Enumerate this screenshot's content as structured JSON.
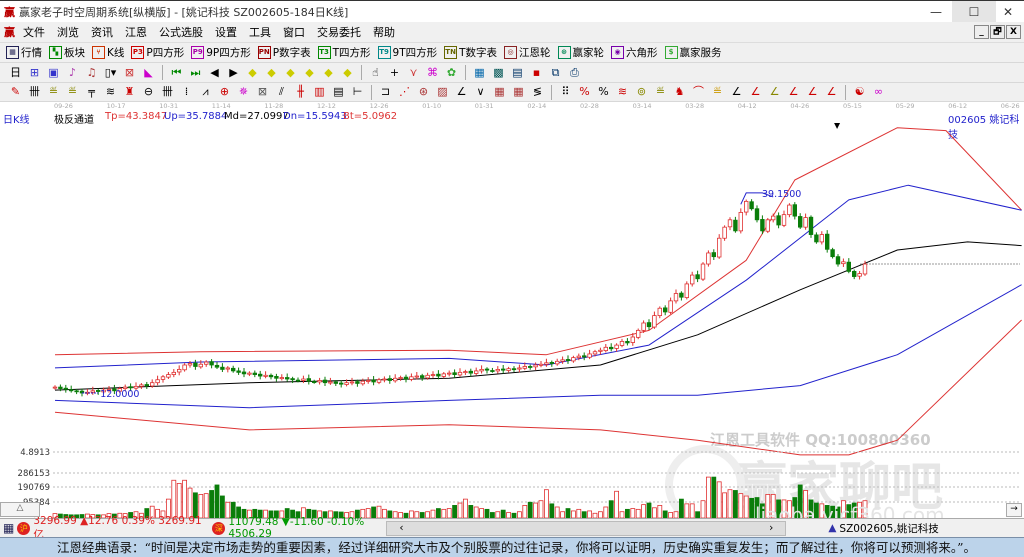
{
  "window": {
    "title": "赢家老子时空周期系统[纵横版] - [姚记科技  SZ002605-184日K线]",
    "logo": "赢",
    "minimize": "—",
    "maximize": "☐",
    "close": "✕"
  },
  "menu": [
    "文件",
    "浏览",
    "资讯",
    "江恩",
    "公式选股",
    "设置",
    "工具",
    "窗口",
    "交易委托",
    "帮助"
  ],
  "mdi": [
    "_",
    "🗗",
    "X"
  ],
  "toolbar1": [
    {
      "icon": "grid-icon",
      "glyph": "▦",
      "color": "#225",
      "label": "行情"
    },
    {
      "icon": "blocks-icon",
      "glyph": "▚",
      "color": "#080",
      "label": "板块"
    },
    {
      "icon": "kline-icon",
      "glyph": "⑂",
      "color": "#c30",
      "label": "K线"
    },
    {
      "icon": "p3-icon",
      "glyph": "P3",
      "color": "#c00",
      "label": "P四方形"
    },
    {
      "icon": "p9-icon",
      "glyph": "P9",
      "color": "#a0a",
      "label": "9P四方形"
    },
    {
      "icon": "pn-icon",
      "glyph": "PN",
      "color": "#900",
      "label": "P数字表"
    },
    {
      "icon": "t3-icon",
      "glyph": "T3",
      "color": "#080",
      "label": "T四方形"
    },
    {
      "icon": "t9-icon",
      "glyph": "T9",
      "color": "#088",
      "label": "9T四方形"
    },
    {
      "icon": "tn-icon",
      "glyph": "TN",
      "color": "#660",
      "label": "T数字表"
    },
    {
      "icon": "target-icon",
      "glyph": "◎",
      "color": "#822",
      "label": "江恩轮"
    },
    {
      "icon": "wheel-icon",
      "glyph": "⊛",
      "color": "#085",
      "label": "赢家轮"
    },
    {
      "icon": "hexagon-icon",
      "glyph": "◉",
      "color": "#70a",
      "label": "六角形"
    },
    {
      "icon": "dollar-icon",
      "glyph": "$",
      "color": "#3a3",
      "label": "赢家服务"
    }
  ],
  "toolbar2": [
    [
      "period-day-icon",
      "日▾",
      "#000"
    ],
    [
      "draw-icon",
      "⊞",
      "#33c"
    ],
    [
      "note-icon",
      "▣",
      "#33c"
    ],
    [
      "wave-icon",
      "♪",
      "#a3a"
    ],
    [
      "wave2-icon",
      "♫",
      "#a33"
    ],
    [
      "candle-icon",
      "▯▾",
      "#000"
    ],
    [
      "cross-icon",
      "⊠",
      "#c33"
    ],
    [
      "chart-flag-icon",
      "◣",
      "#c0c"
    ],
    [
      "sep"
    ],
    [
      "first-icon",
      "⏮",
      "#080"
    ],
    [
      "last-icon",
      "⏭",
      "#080"
    ],
    [
      "left-icon",
      "◀",
      "#000"
    ],
    [
      "right-icon",
      "▶",
      "#000"
    ],
    [
      "diamond1-icon",
      "◆",
      "#cc0"
    ],
    [
      "diamond2-icon",
      "◆",
      "#cc0"
    ],
    [
      "diamond3-icon",
      "◆",
      "#cc0"
    ],
    [
      "diamond4-icon",
      "◆",
      "#cc0"
    ],
    [
      "diamond5-icon",
      "◆",
      "#cc0"
    ],
    [
      "diamond6-icon",
      "◆",
      "#cc0"
    ],
    [
      "sep"
    ],
    [
      "hand-icon",
      "☝",
      "#000"
    ],
    [
      "crosshair-icon",
      "+",
      "#000"
    ],
    [
      "zigzag-icon",
      "⋎",
      "#c33"
    ],
    [
      "gift-icon",
      "⌘",
      "#c0c"
    ],
    [
      "people-icon",
      "✿",
      "#3a3"
    ],
    [
      "sep"
    ],
    [
      "calendar-icon",
      "▦",
      "#06a"
    ],
    [
      "calc-icon",
      "▩",
      "#055"
    ],
    [
      "doc-icon",
      "▤",
      "#036"
    ],
    [
      "save-icon",
      "▪",
      "#c00"
    ],
    [
      "network-icon",
      "⧉",
      "#036"
    ],
    [
      "print-icon",
      "⎙",
      "#036"
    ]
  ],
  "toolbar3": [
    [
      "pen-icon",
      "✎",
      "#c00"
    ],
    [
      "bars-icon",
      "卌",
      "#000"
    ],
    [
      "gold1-icon",
      "≝",
      "#880"
    ],
    [
      "gold2-icon",
      "≝",
      "#880"
    ],
    [
      "fork-icon",
      "╤",
      "#000"
    ],
    [
      "coil-icon",
      "≋",
      "#000"
    ],
    [
      "pin-icon",
      "♜",
      "#c00"
    ],
    [
      "circle-lines-icon",
      "⊖",
      "#000"
    ],
    [
      "bars2-icon",
      "卌",
      "#000"
    ],
    [
      "grid-n-icon",
      "⁞",
      "#000"
    ],
    [
      "fan-icon",
      "⩘",
      "#000"
    ],
    [
      "cross-circle-icon",
      "⊕",
      "#c00"
    ],
    [
      "star-icon",
      "✵",
      "#c0c"
    ],
    [
      "box-x-icon",
      "⊠",
      "#555"
    ],
    [
      "slant-icon",
      "⫽",
      "#000"
    ],
    [
      "red-fork-icon",
      "╫",
      "#c00"
    ],
    [
      "red-box-icon",
      "▥",
      "#c00"
    ],
    [
      "stack-icon",
      "▤",
      "#000"
    ],
    [
      "span-icon",
      "⊢",
      "#000"
    ],
    [
      "sep"
    ],
    [
      "frame-icon",
      "⊐",
      "#000"
    ],
    [
      "ray-icon",
      "⋰",
      "#c00"
    ],
    [
      "spiral-icon",
      "⊛",
      "#a33"
    ],
    [
      "grid-red-icon",
      "▨",
      "#a33"
    ],
    [
      "angle-icon",
      "∠",
      "#000"
    ],
    [
      "vee-icon",
      "∨",
      "#000"
    ],
    [
      "mesh-icon",
      "▦",
      "#a33"
    ],
    [
      "mesh2-icon",
      "▦",
      "#a33"
    ],
    [
      "lines-icon",
      "≶",
      "#000"
    ],
    [
      "sep"
    ],
    [
      "matrix-icon",
      "⠿",
      "#000"
    ],
    [
      "percent-red-icon",
      "%",
      "#c00"
    ],
    [
      "percent-icon",
      "%",
      "#000"
    ],
    [
      "percent-lines-icon",
      "≋",
      "#c00"
    ],
    [
      "coin-icon",
      "⊚",
      "#880"
    ],
    [
      "gold3-icon",
      "≝",
      "#880"
    ],
    [
      "bull-icon",
      "♞",
      "#c00"
    ],
    [
      "arc-icon",
      "⌒",
      "#c00"
    ],
    [
      "gold4-icon",
      "≝",
      "#c90"
    ],
    [
      "angle2-icon",
      "∠",
      "#000"
    ],
    [
      "angle3-icon",
      "∠",
      "#c00"
    ],
    [
      "angle4-icon",
      "∠",
      "#880"
    ],
    [
      "angle5-icon",
      "∠",
      "#c00"
    ],
    [
      "angle6-icon",
      "∠",
      "#c00"
    ],
    [
      "angle7-icon",
      "∠",
      "#c00"
    ],
    [
      "sep"
    ],
    [
      "yinyang-icon",
      "☯",
      "#c00"
    ],
    [
      "infinity-icon",
      "∞",
      "#c0c"
    ]
  ],
  "date_axis": [
    "09-26",
    "10-17",
    "10-31",
    "11-14",
    "11-28",
    "12-12",
    "12-26",
    "01-10",
    "01-31",
    "02-14",
    "02-28",
    "03-14",
    "03-28",
    "04-12",
    "04-26",
    "05-15",
    "05-29",
    "06-12",
    "06-26"
  ],
  "indicator": {
    "period": "日K线",
    "name": "极反通道",
    "tp": "Tp=43.3847",
    "up": "Up=35.7884",
    "md": "Md=27.0997",
    "dn": "Dn=15.5943",
    "bt": "Bt=5.0962",
    "stock": "002605  姚记科技"
  },
  "colors": {
    "up": "#e03030",
    "down": "#0a7d0a",
    "tp": "#d33",
    "upline": "#2222cc",
    "md": "#000",
    "dn": "#2222cc",
    "bt": "#d33"
  },
  "chart_data": {
    "type": "candlestick",
    "title": "姚记科技 SZ002605 日K线",
    "annotations": {
      "high": "39.1500",
      "low": "12.0000",
      "high_value": 39.15,
      "low_value": 12.0
    },
    "close": [
      12.8,
      12.6,
      12.5,
      12.3,
      12.2,
      12.0,
      12.1,
      12.3,
      12.2,
      12.4,
      12.5,
      12.3,
      12.6,
      12.8,
      12.7,
      12.9,
      13.1,
      13.0,
      13.4,
      13.8,
      14.2,
      14.5,
      14.8,
      15.2,
      15.8,
      16.0,
      15.6,
      15.9,
      16.2,
      15.8,
      15.5,
      15.2,
      15.4,
      15.0,
      14.8,
      14.6,
      14.7,
      14.5,
      14.3,
      14.4,
      14.2,
      14.0,
      14.1,
      13.9,
      13.8,
      13.7,
      13.9,
      13.6,
      13.5,
      13.7,
      13.4,
      13.5,
      13.3,
      13.2,
      13.4,
      13.5,
      13.3,
      13.6,
      13.7,
      13.5,
      13.8,
      13.9,
      13.7,
      14.0,
      14.1,
      13.9,
      14.2,
      14.3,
      14.1,
      14.4,
      14.5,
      14.3,
      14.6,
      14.7,
      14.5,
      14.8,
      14.9,
      14.7,
      15.0,
      15.2,
      15.1,
      15.0,
      15.2,
      15.1,
      15.3,
      15.2,
      15.4,
      15.6,
      15.5,
      15.8,
      15.9,
      16.1,
      16.0,
      16.3,
      16.5,
      16.4,
      16.8,
      17.0,
      16.9,
      17.3,
      17.6,
      17.8,
      18.2,
      18.0,
      18.5,
      19.0,
      18.8,
      19.6,
      20.5,
      21.5,
      21.0,
      22.5,
      23.5,
      23.0,
      24.5,
      25.5,
      25.0,
      26.8,
      28.0,
      27.5,
      29.5,
      31.0,
      30.5,
      33.0,
      34.5,
      35.5,
      34.0,
      36.5,
      38.0,
      37.0,
      35.5,
      34.0,
      35.5,
      36.0,
      34.8,
      36.2,
      37.5,
      36.0,
      34.5,
      35.8,
      33.5,
      32.5,
      33.5,
      31.5,
      30.5,
      29.5,
      29.8,
      28.5,
      27.8,
      28.2,
      29.5
    ],
    "volume": [
      28000,
      25000,
      22000,
      20000,
      20000,
      22000,
      25000,
      22000,
      20000,
      20000,
      28000,
      25000,
      30000,
      28000,
      35000,
      40000,
      30000,
      60000,
      75000,
      55000,
      45000,
      120000,
      240000,
      220000,
      240000,
      190000,
      160000,
      150000,
      155000,
      175000,
      210000,
      140000,
      100000,
      100000,
      70000,
      55000,
      50000,
      55000,
      50000,
      50000,
      45000,
      45000,
      45000,
      60000,
      50000,
      40000,
      65000,
      55000,
      50000,
      45000,
      40000,
      45000,
      40000,
      38000,
      35000,
      40000,
      50000,
      55000,
      60000,
      70000,
      75000,
      55000,
      45000,
      40000,
      35000,
      30000,
      45000,
      40000,
      35000,
      40000,
      50000,
      60000,
      55000,
      60000,
      80000,
      95000,
      120000,
      80000,
      70000,
      60000,
      55000,
      35000,
      40000,
      50000,
      35000,
      30000,
      40000,
      80000,
      100000,
      95000,
      110000,
      180000,
      90000,
      70000,
      40000,
      60000,
      45000,
      55000,
      40000,
      45000,
      30000,
      40000,
      70000,
      110000,
      170000,
      40000,
      55000,
      60000,
      55000,
      85000,
      95000,
      65000,
      80000,
      45000,
      35000,
      40000,
      120000,
      90000,
      90000,
      40000,
      110000,
      260000,
      260000,
      230000,
      160000,
      180000,
      175000,
      155000,
      140000,
      125000,
      130000,
      90000,
      150000,
      150000,
      115000,
      115000,
      110000,
      130000,
      210000,
      175000,
      115000,
      95000,
      90000,
      80000,
      75000,
      70000,
      110000,
      85000,
      95000,
      100000,
      110000
    ],
    "bands": {
      "Tp": [
        [
          0,
          17.2
        ],
        [
          27,
          17.6
        ],
        [
          73,
          17.8
        ],
        [
          91,
          17.2
        ],
        [
          110,
          20.5
        ],
        [
          128,
          30
        ],
        [
          137,
          40.9
        ],
        [
          156,
          48
        ],
        [
          165,
          47.6
        ],
        [
          179,
          36.8
        ]
      ],
      "Up": [
        [
          0,
          15.4
        ],
        [
          27,
          16.2
        ],
        [
          73,
          16.7
        ],
        [
          91,
          15.8
        ],
        [
          110,
          18.5
        ],
        [
          128,
          27.3
        ],
        [
          147,
          38.2
        ],
        [
          158,
          40.2
        ],
        [
          179,
          36.8
        ]
      ],
      "Md": [
        [
          0,
          12.4
        ],
        [
          36,
          13.4
        ],
        [
          73,
          14
        ],
        [
          101,
          15.8
        ],
        [
          119,
          19.9
        ],
        [
          138,
          26
        ],
        [
          156,
          31.4
        ],
        [
          169,
          32.5
        ],
        [
          179,
          32
        ]
      ],
      "Dn": [
        [
          0,
          11
        ],
        [
          36,
          10
        ],
        [
          73,
          11
        ],
        [
          101,
          11.7
        ],
        [
          119,
          11.7
        ],
        [
          138,
          13
        ],
        [
          156,
          17.2
        ],
        [
          179,
          26.7
        ]
      ],
      "Bt": [
        [
          0,
          9.4
        ],
        [
          36,
          7
        ],
        [
          73,
          7.7
        ],
        [
          101,
          7
        ],
        [
          119,
          5.6
        ],
        [
          138,
          3.6
        ],
        [
          147,
          3.6
        ],
        [
          156,
          5.6
        ],
        [
          179,
          21.9
        ]
      ]
    },
    "last_price_line": 29.5,
    "volume_axis": [
      "4.8913",
      "286153",
      "190769",
      "95384"
    ],
    "volume_ticks": [
      286153,
      190769,
      95384
    ]
  },
  "watermark": {
    "line1": "江恩工具软件  QQ:100800360",
    "line2": "赢家聊吧",
    "line3": "liaoba.yjcf360.com"
  },
  "status": {
    "sh_badge": "沪",
    "sh": "3296.99 ▲12.76 0.39% 3269.91亿",
    "sz_badge": "深",
    "sz": "11079.48 ▼-11.60 -0.10% 4506.29",
    "scroll_left": "‹",
    "scroll_right": "›",
    "stock": "SZ002605,姚记科技",
    "collapse": "△",
    "arrow": "→"
  },
  "quote": "江恩经典语录：“时间是决定市场走势的重要因素，经过详细研究大市及个别股票的过往记录，你将可以证明，历史确实重复发生；而了解过往，你将可以预测将来。”。"
}
